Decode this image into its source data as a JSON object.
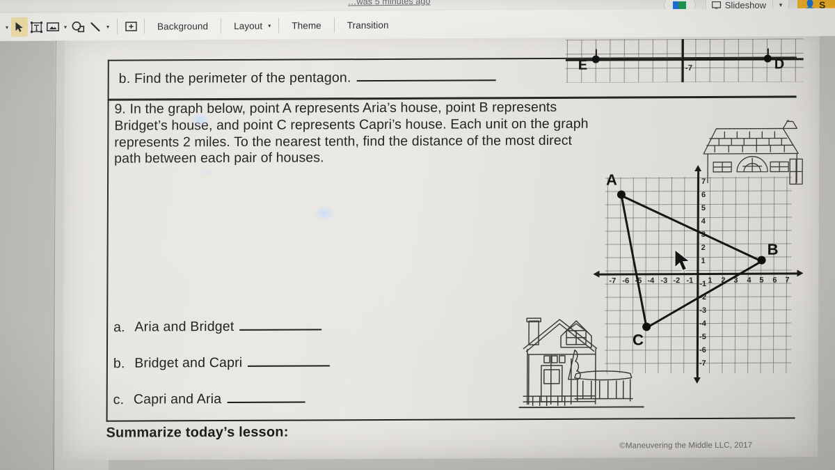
{
  "app": {
    "doc_status": "…was 5 minutes ago",
    "slideshow_label": "Slideshow",
    "share_label": "S",
    "toolbar": {
      "undo_caret": "▾",
      "select_icon": "cursor-arrow",
      "textbox_icon": "text-box",
      "image_icon": "insert-image",
      "image_caret": "▾",
      "shape_icon": "insert-shape",
      "line_icon": "insert-line",
      "line_caret": "▾",
      "comment_icon": "add-comment",
      "background_label": "Background",
      "layout_label": "Layout",
      "layout_caret": "▾",
      "theme_label": "Theme",
      "transition_label": "Transition"
    }
  },
  "worksheet": {
    "question_b": "b.  Find the perimeter of the pentagon.",
    "question_9": "9. In the graph below, point A represents Aria’s house, point B represents Bridget’s house, and point C represents Capri’s house. Each unit on the graph represents 2 miles. To the nearest tenth, find the distance of the most direct path between each pair of houses.",
    "answers": [
      {
        "letter": "a.",
        "text": "Aria and Bridget"
      },
      {
        "letter": "b.",
        "text": "Bridget and Capri"
      },
      {
        "letter": "c.",
        "text": "Capri and Aria"
      }
    ],
    "summarize": "Summarize today’s lesson:",
    "copyright": "©Maneuvering the Middle LLC, 2017"
  },
  "chart_data": [
    {
      "type": "scatter",
      "title": "Coordinate plane with triangle ABC",
      "xlabel": "",
      "ylabel": "",
      "xlim": [
        -7,
        7
      ],
      "ylim": [
        -7,
        7
      ],
      "grid": true,
      "x_ticks": [
        "-7",
        "-6",
        "-5",
        "-4",
        "-3",
        "-2",
        "-1",
        "1",
        "2",
        "3",
        "4",
        "5",
        "6",
        "7"
      ],
      "y_ticks": [
        "7",
        "6",
        "5",
        "4",
        "3",
        "2",
        "1",
        "-1",
        "-2",
        "-3",
        "-4",
        "-5",
        "-6",
        "-7"
      ],
      "points": [
        {
          "label": "A",
          "x": -6,
          "y": 6
        },
        {
          "label": "B",
          "x": 5,
          "y": 1
        },
        {
          "label": "C",
          "x": -4,
          "y": -4
        }
      ],
      "segments": [
        {
          "from": "A",
          "to": "B"
        },
        {
          "from": "B",
          "to": "C"
        },
        {
          "from": "C",
          "to": "A"
        }
      ],
      "unit_scale_note": "Each unit on the graph represents 2 miles."
    },
    {
      "type": "scatter",
      "title": "Partial coordinate plane with points E and D",
      "grid": true,
      "y_tick_visible": "-7",
      "points": [
        {
          "label": "E",
          "x": -6,
          "y": 0
        },
        {
          "label": "D",
          "x": 6,
          "y": 0
        }
      ]
    }
  ]
}
